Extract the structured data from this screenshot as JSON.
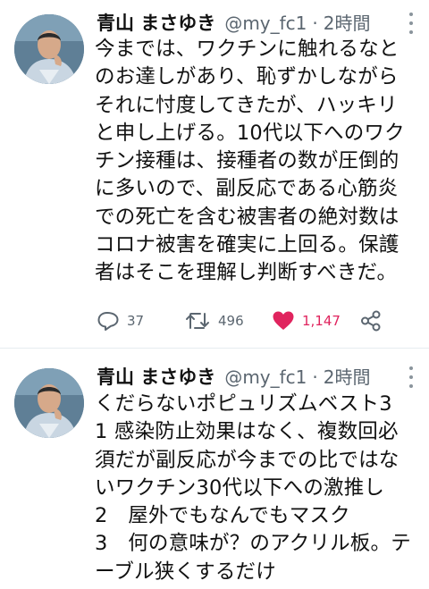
{
  "tweets": [
    {
      "author": "青山 まさゆき",
      "handle": "@my_fc1",
      "separator": "·",
      "time": "2時間",
      "lines": [
        "今までは、ワクチンに触れるなと",
        "のお達しがあり、恥ずかしながら",
        "それに忖度してきたが、ハッキリ",
        "と申し上げる。10代以下へのワク",
        "チン接種は、接種者の数が圧倒的",
        "に多いので、副反応である心筋炎",
        "での死亡を含む被害者の絶対数は",
        "コロナ被害を確実に上回る。保護",
        "者はそこを理解し判断すべきだ。"
      ],
      "actions": {
        "reply_count": "37",
        "retweet_count": "496",
        "like_count": "1,147",
        "liked": true
      }
    },
    {
      "author": "青山 まさゆき",
      "handle": "@my_fc1",
      "separator": "·",
      "time": "2時間",
      "lines": [
        "くだらないポピュリズムベスト3",
        "1 感染防止効果はなく、複数回必",
        "須だが副反応が今までの比ではな",
        "いワクチン30代以下への激推し",
        "2　屋外でもなんでもマスク",
        "3　何の意味が？のアクリル板。テ",
        "ーブル狭くするだけ"
      ]
    }
  ],
  "colors": {
    "text": "#111111",
    "secondary": "#5b6670",
    "like": "#e0245e",
    "divider": "#e6ecf0"
  },
  "icons": [
    "reply-icon",
    "retweet-icon",
    "heart-icon",
    "share-icon",
    "more-icon"
  ]
}
